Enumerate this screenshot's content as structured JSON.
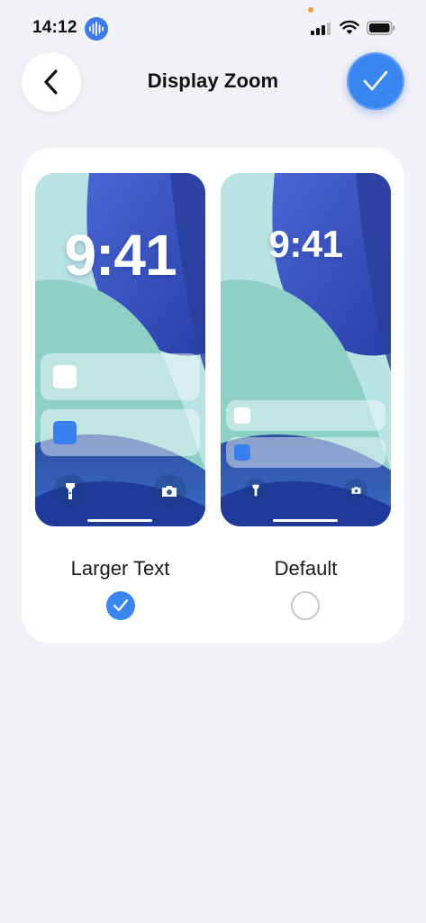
{
  "status_bar": {
    "time": "14:12",
    "voice_icon": "waveform-icon",
    "privacy_indicator_color": "#f29a38"
  },
  "nav": {
    "back_icon": "chevron-left-icon",
    "title": "Display Zoom",
    "done_icon": "checkmark-icon",
    "accent_color": "#3a86f0"
  },
  "options": [
    {
      "label": "Larger Text",
      "selected": true,
      "preview": {
        "time": "9:41"
      }
    },
    {
      "label": "Default",
      "selected": false,
      "preview": {
        "time": "9:41"
      }
    }
  ]
}
